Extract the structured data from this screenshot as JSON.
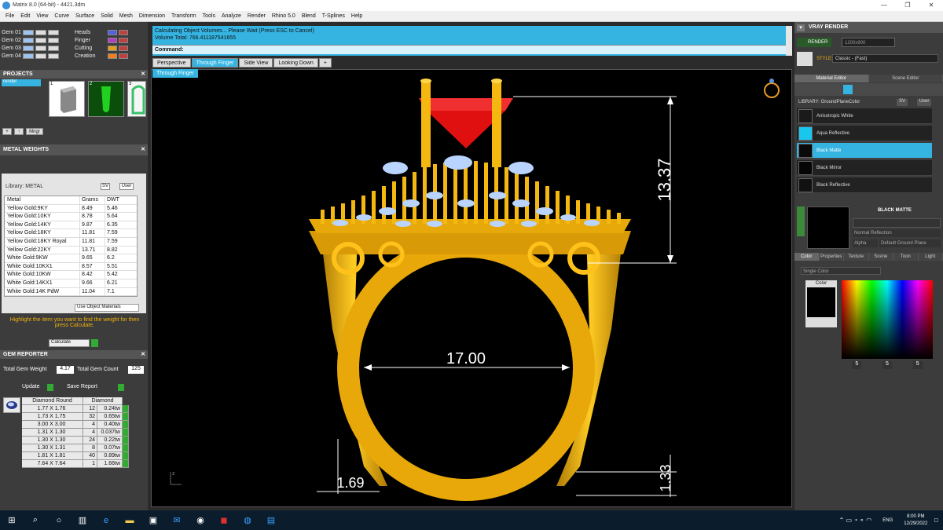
{
  "window": {
    "title": "Matrix 8.0 (64-bit) - 4421.3dm"
  },
  "menu": [
    "File",
    "Edit",
    "View",
    "Curve",
    "Surface",
    "Solid",
    "Mesh",
    "Dimension",
    "Transform",
    "Tools",
    "Analyze",
    "Render",
    "Rhino 5.0",
    "Blend",
    "T-Splines",
    "Help"
  ],
  "gems": [
    "Gem 01",
    "Gem 02",
    "Gem 03",
    "Gem 04"
  ],
  "settings": [
    "Heads",
    "Finger",
    "Cutting",
    "Creation"
  ],
  "projects": {
    "title": "PROJECTS",
    "item": "render",
    "thumbs": [
      "1",
      "2",
      "3"
    ],
    "mngr": "Mngr"
  },
  "metal": {
    "title": "METAL WEIGHTS",
    "library_label": "Library: METAL",
    "sv": "SV",
    "user": "User",
    "headers": [
      "Metal",
      "Grams",
      "DWT"
    ],
    "rows": [
      [
        "Yellow Gold:9KY",
        "8.49",
        "5.46"
      ],
      [
        "Yellow Gold:10KY",
        "8.78",
        "5.64"
      ],
      [
        "Yellow Gold:14KY",
        "9.87",
        "6.35"
      ],
      [
        "Yellow Gold:18KY",
        "11.81",
        "7.59"
      ],
      [
        "Yellow Gold:18KY Royal",
        "11.81",
        "7.59"
      ],
      [
        "Yellow Gold:22KY",
        "13.71",
        "8.82"
      ],
      [
        "White Gold:9KW",
        "9.65",
        "6.2"
      ],
      [
        "White Gold:10KX1",
        "8.57",
        "5.51"
      ],
      [
        "White Gold:10KW",
        "8.42",
        "5.42"
      ],
      [
        "White Gold:14KX1",
        "9.66",
        "6.21"
      ],
      [
        "White Gold:14K PdW",
        "11.04",
        "7.1"
      ]
    ],
    "use_object": "Use Object Materials",
    "hint": "Highlight the item you want to find the weight for then press Calculate.",
    "calculate": "Calculate"
  },
  "gem_reporter": {
    "title": "GEM REPORTER",
    "total_weight_label": "Total Gem Weight",
    "total_weight": "4.17",
    "total_count_label": "Total Gem Count",
    "total_count": "125",
    "update": "Update",
    "save": "Save Report",
    "headers": [
      "Diamond Round",
      "Diamond"
    ],
    "rows": [
      [
        "1.77 X 1.76",
        "12",
        "0.24tw"
      ],
      [
        "1.73 X 1.75",
        "32",
        "0.65tw"
      ],
      [
        "3.00 X 3.00",
        "4",
        "0.40tw"
      ],
      [
        "1.31 X 1.30",
        "4",
        "0.037tw"
      ],
      [
        "1.30 X 1.30",
        "24",
        "0.22tw"
      ],
      [
        "1.30 X 1.31",
        "8",
        "0.07tw"
      ],
      [
        "1.81 X 1.81",
        "40",
        "0.89tw"
      ],
      [
        "7.64 X 7.64",
        "1",
        "1.66tw"
      ]
    ]
  },
  "command": {
    "line1": "Calculating Object Volumes... Please Wait (Press ESC to Cancel)",
    "line2": "Volume Total: 766.411187541655",
    "label": "Command:"
  },
  "tabs": [
    "Perspective",
    "Through Finger",
    "Side View",
    "Looking Down",
    "+"
  ],
  "viewport": {
    "label": "Through Finger",
    "dim_height": "13.37",
    "dim_width": "17.00",
    "dim_side": "1.69",
    "dim_bottom": "1.33",
    "axis": "z"
  },
  "vray": {
    "title": "VRAY RENDER",
    "render": "RENDER",
    "resolution": "1200x900",
    "style_label": "STYLE:",
    "style": "Classic - (Fast)",
    "tabs": [
      "Material Editor",
      "Scene Editor"
    ],
    "library": "LIBRARY: GroundPlaneColor",
    "sv": "SV",
    "user": "User",
    "materials": [
      {
        "name": "Anisotropic White",
        "color": "#1a1a1a"
      },
      {
        "name": "Aqua Reflective",
        "color": "#19c7ee"
      },
      {
        "name": "Black Matte",
        "color": "#0a0a0a"
      },
      {
        "name": "Black Mirror",
        "color": "#050505"
      },
      {
        "name": "Black Reflective",
        "color": "#111111"
      }
    ],
    "selected_name": "BLACK MATTE",
    "reflection": "Normal Reflection",
    "alpha": "Alpha",
    "ground": "Default Ground Plane",
    "subtabs": [
      "Color",
      "Properties",
      "Texture",
      "Scene",
      "Toon",
      "Light"
    ],
    "color_mode": "Single Color",
    "color_label": "Color",
    "rgb": [
      "5",
      "5",
      "5"
    ]
  },
  "taskbar": {
    "time": "8:00 PM",
    "date": "12/29/2022",
    "lang": "ENG"
  },
  "colors": {
    "accent": "#35b4e2",
    "gold": "#f2b20d",
    "ruby": "#e01010",
    "diamond": "#b9d4ff"
  }
}
